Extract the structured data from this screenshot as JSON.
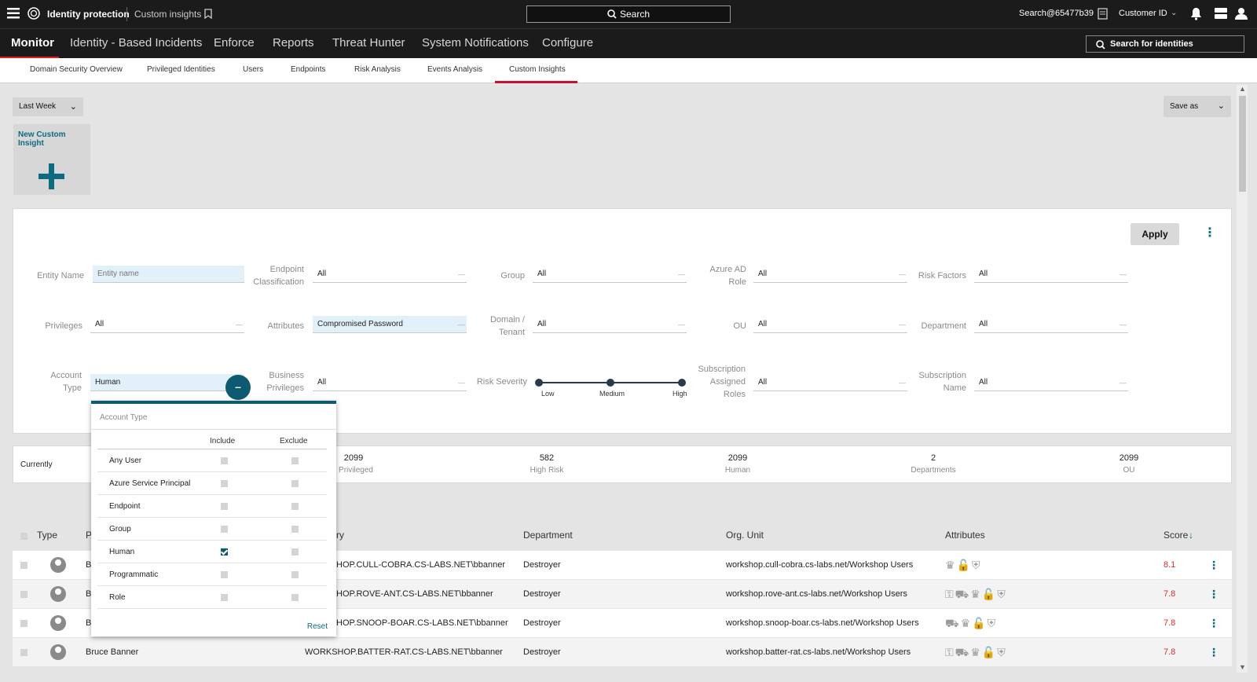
{
  "topbar": {
    "app_title": "Identity protection",
    "breadcrumb": "Custom insights",
    "search_label": "Search",
    "account": "Search@65477b39",
    "customer": "Customer ID"
  },
  "nav": {
    "items": [
      "Monitor",
      "Identity - Based Incidents",
      "Enforce",
      "Reports",
      "Threat Hunter",
      "System Notifications",
      "Configure"
    ],
    "identity_search_placeholder": "Search for identities"
  },
  "subnav": {
    "tabs": [
      "Domain Security Overview",
      "Privileged Identities",
      "Users",
      "Endpoints",
      "Risk Analysis",
      "Events Analysis",
      "Custom Insights"
    ],
    "active": "Custom Insights"
  },
  "controls": {
    "range": "Last Week",
    "save_as": "Save as",
    "new_insight": "New Custom Insight"
  },
  "filters": {
    "apply": "Apply",
    "entity_name": {
      "label": "Entity Name",
      "placeholder": "Entity name"
    },
    "endpoint_classification": {
      "label1": "Endpoint",
      "label2": "Classification",
      "value": "All"
    },
    "group": {
      "label": "Group",
      "value": "All"
    },
    "azure_ad_role": {
      "label1": "Azure AD",
      "label2": "Role",
      "value": "All"
    },
    "risk_factors": {
      "label": "Risk Factors",
      "value": "All"
    },
    "privileges": {
      "label": "Privileges",
      "value": "All"
    },
    "attributes": {
      "label": "Attributes",
      "value": "Compromised Password"
    },
    "domain_tenant": {
      "label1": "Domain /",
      "label2": "Tenant",
      "value": "All"
    },
    "ou": {
      "label": "OU",
      "value": "All"
    },
    "department": {
      "label": "Department",
      "value": "All"
    },
    "account_type": {
      "label1": "Account",
      "label2": "Type",
      "value": "Human"
    },
    "business_privileges": {
      "label1": "Business",
      "label2": "Privileges",
      "value": "All"
    },
    "risk_severity": {
      "label": "Risk Severity",
      "low": "Low",
      "medium": "Medium",
      "high": "High"
    },
    "subscription_roles": {
      "label1": "Subscription",
      "label2": "Assigned",
      "label3": "Roles",
      "value": "All"
    },
    "subscription_name": {
      "label1": "Subscription",
      "label2": "Name",
      "value": "All"
    }
  },
  "dropdown": {
    "title": "Account Type",
    "include": "Include",
    "exclude": "Exclude",
    "options": [
      "Any User",
      "Azure Service Principal",
      "Endpoint",
      "Group",
      "Human",
      "Programmatic",
      "Role"
    ],
    "checked_include": "Human",
    "reset": "Reset"
  },
  "stats": {
    "currently": "Currently",
    "items": [
      {
        "value": "2099",
        "label": "Privileged"
      },
      {
        "value": "582",
        "label": "High Risk"
      },
      {
        "value": "2099",
        "label": "Human"
      },
      {
        "value": "2",
        "label": "Departments"
      },
      {
        "value": "2099",
        "label": "OU"
      }
    ]
  },
  "table": {
    "headers": {
      "type": "Type",
      "p": "P",
      "ry": "ry",
      "department": "Department",
      "org_unit": "Org. Unit",
      "attributes": "Attributes",
      "score": "Score"
    },
    "rows": [
      {
        "name": "B",
        "account": "HOP.CULL-COBRA.CS-LABS.NET\\bbanner",
        "department": "Destroyer",
        "org_unit": "workshop.cull-cobra.cs-labs.net/Workshop Users",
        "attrs": "♛🔓⛨",
        "score": "8.1"
      },
      {
        "name": "B",
        "account": "HOP.ROVE-ANT.CS-LABS.NET\\bbanner",
        "department": "Destroyer",
        "org_unit": "workshop.rove-ant.cs-labs.net/Workshop Users",
        "attrs": "⚿⛟♛🔓⛨",
        "score": "7.8"
      },
      {
        "name": "B",
        "account": "HOP.SNOOP-BOAR.CS-LABS.NET\\bbanner",
        "department": "Destroyer",
        "org_unit": "workshop.snoop-boar.cs-labs.net/Workshop Users",
        "attrs": "⛟♛🔓⛨",
        "score": "7.8"
      },
      {
        "name": "Bruce Banner",
        "account": "WORKSHOP.BATTER-RAT.CS-LABS.NET\\bbanner",
        "department": "Destroyer",
        "org_unit": "workshop.batter-rat.cs-labs.net/Workshop Users",
        "attrs": "⚿⛟♛🔓⛨",
        "score": "7.8"
      }
    ]
  }
}
